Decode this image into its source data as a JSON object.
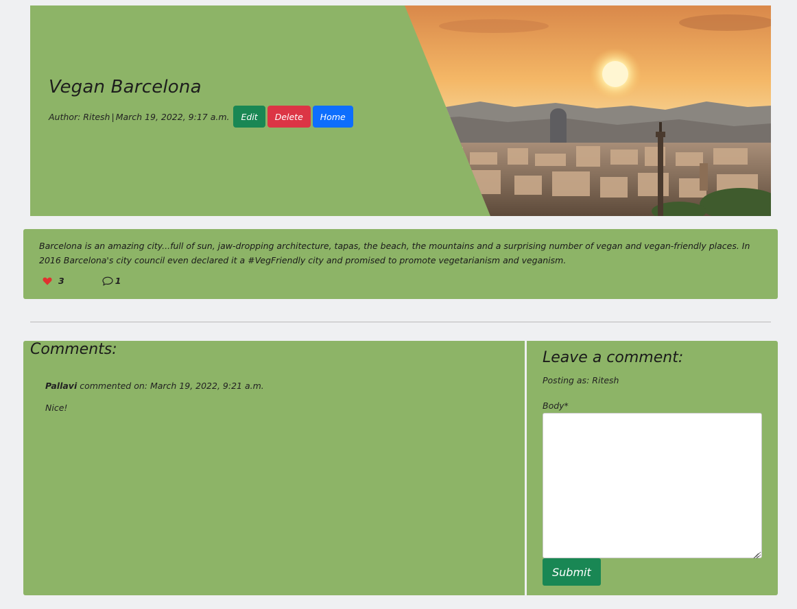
{
  "post": {
    "title": "Vegan Barcelona",
    "author_label": "Author:",
    "author": "Ritesh",
    "separator": "|",
    "date": "March 19, 2022, 9:17 a.m.",
    "hero_image": "barcelona-skyline-sunset"
  },
  "actions": {
    "edit": "Edit",
    "delete": "Delete",
    "home": "Home"
  },
  "content": {
    "text": "Barcelona is an amazing city...full of sun, jaw-dropping architecture, tapas, the beach, the mountains and a surprising number of vegan and vegan-friendly places. In 2016 Barcelona's city council even declared it a #VegFriendly city and promised to promote vegetarianism and veganism.",
    "likes": "3",
    "comments": "1",
    "like_icon": "heart-icon",
    "comment_icon": "chat-icon"
  },
  "comments": {
    "heading": "Comments:",
    "items": [
      {
        "author": "Pallavi",
        "meta": " commented on: March 19, 2022, 9:21 a.m.",
        "body": "Nice!"
      }
    ]
  },
  "form": {
    "heading": "Leave a comment:",
    "posting_as": "Posting as: Ritesh",
    "body_label": "Body*",
    "body_value": "",
    "submit": "Submit"
  },
  "colors": {
    "background": "#eff0f2",
    "card_green": "#8db467",
    "edit": "#198754",
    "delete": "#dc3545",
    "home": "#0d6efd",
    "heart": "#e0312f"
  }
}
